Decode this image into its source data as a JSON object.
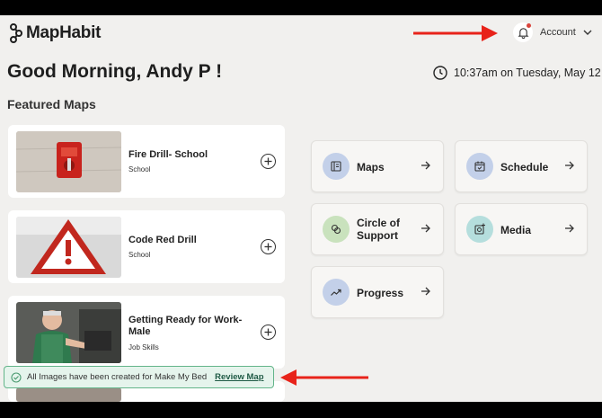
{
  "header": {
    "logo_text": "MapHabit",
    "account_label": "Account"
  },
  "greeting": "Good Morning, Andy P !",
  "datetime": "10:37am on Tuesday, May 12",
  "featured": {
    "title": "Featured Maps",
    "cards": [
      {
        "title": "Fire Drill- School",
        "category": "School"
      },
      {
        "title": "Code Red Drill",
        "category": "School"
      },
      {
        "title": "Getting Ready for Work-Male",
        "category": "Job Skills"
      }
    ]
  },
  "tiles": [
    {
      "label": "Maps",
      "icon": "book-icon",
      "color": "#c3d0e9"
    },
    {
      "label": "Schedule",
      "icon": "calendar-icon",
      "color": "#c3d0e9"
    },
    {
      "label": "Circle of Support",
      "icon": "people-icon",
      "color": "#c9e2bd"
    },
    {
      "label": "Media",
      "icon": "image-add-icon",
      "color": "#b5dedd"
    },
    {
      "label": "Progress",
      "icon": "trend-up-icon",
      "color": "#c3d0e9"
    }
  ],
  "toast": {
    "message": "All Images have been created for Make My Bed",
    "action": "Review Map"
  },
  "colors": {
    "annotation_arrow": "#e8231a",
    "toast_bg": "#e5f4ec",
    "toast_border": "#63b58a"
  }
}
